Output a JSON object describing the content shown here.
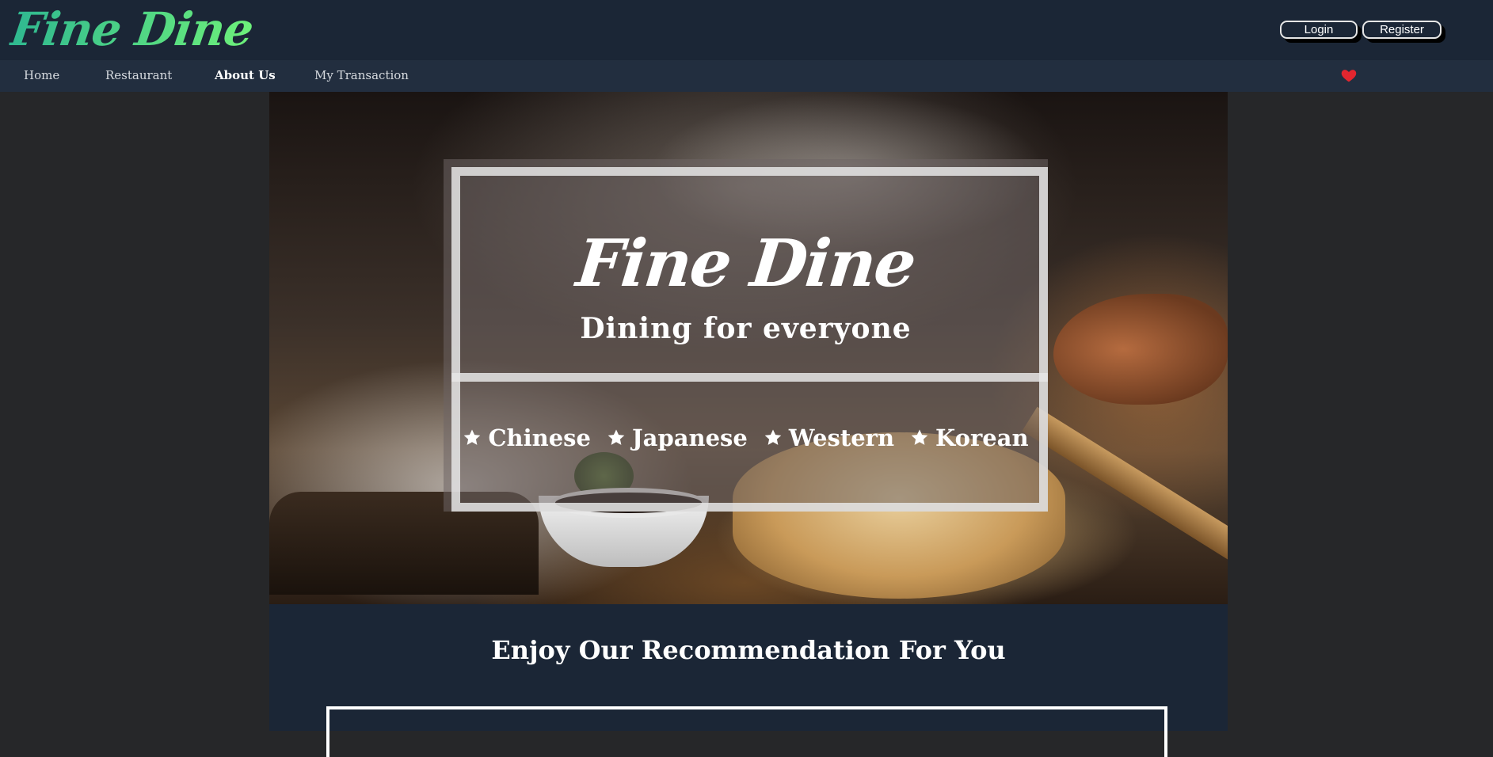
{
  "header": {
    "logo_text": "Fine Dine",
    "login_label": "Login",
    "register_label": "Register"
  },
  "nav": {
    "items": [
      {
        "label": "Home",
        "active": false
      },
      {
        "label": "Restaurant",
        "active": false
      },
      {
        "label": "About Us",
        "active": true
      },
      {
        "label": "My Transaction",
        "active": false
      }
    ],
    "favorites_icon": "heart-icon",
    "favorites_color": "#e3262f"
  },
  "hero": {
    "logo_text": "Fine Dine",
    "tagline": "Dining for everyone",
    "cuisines": [
      "Chinese",
      "Japanese",
      "Western",
      "Korean"
    ],
    "bullet_icon": "star-icon"
  },
  "recommendation": {
    "title": "Enjoy Our Recommendation For You"
  },
  "colors": {
    "header_bg": "#1b2636",
    "nav_bg": "#222e3f",
    "page_bg": "#262729",
    "logo_gradient_start": "#2fb890",
    "logo_gradient_end": "#6df07a"
  }
}
